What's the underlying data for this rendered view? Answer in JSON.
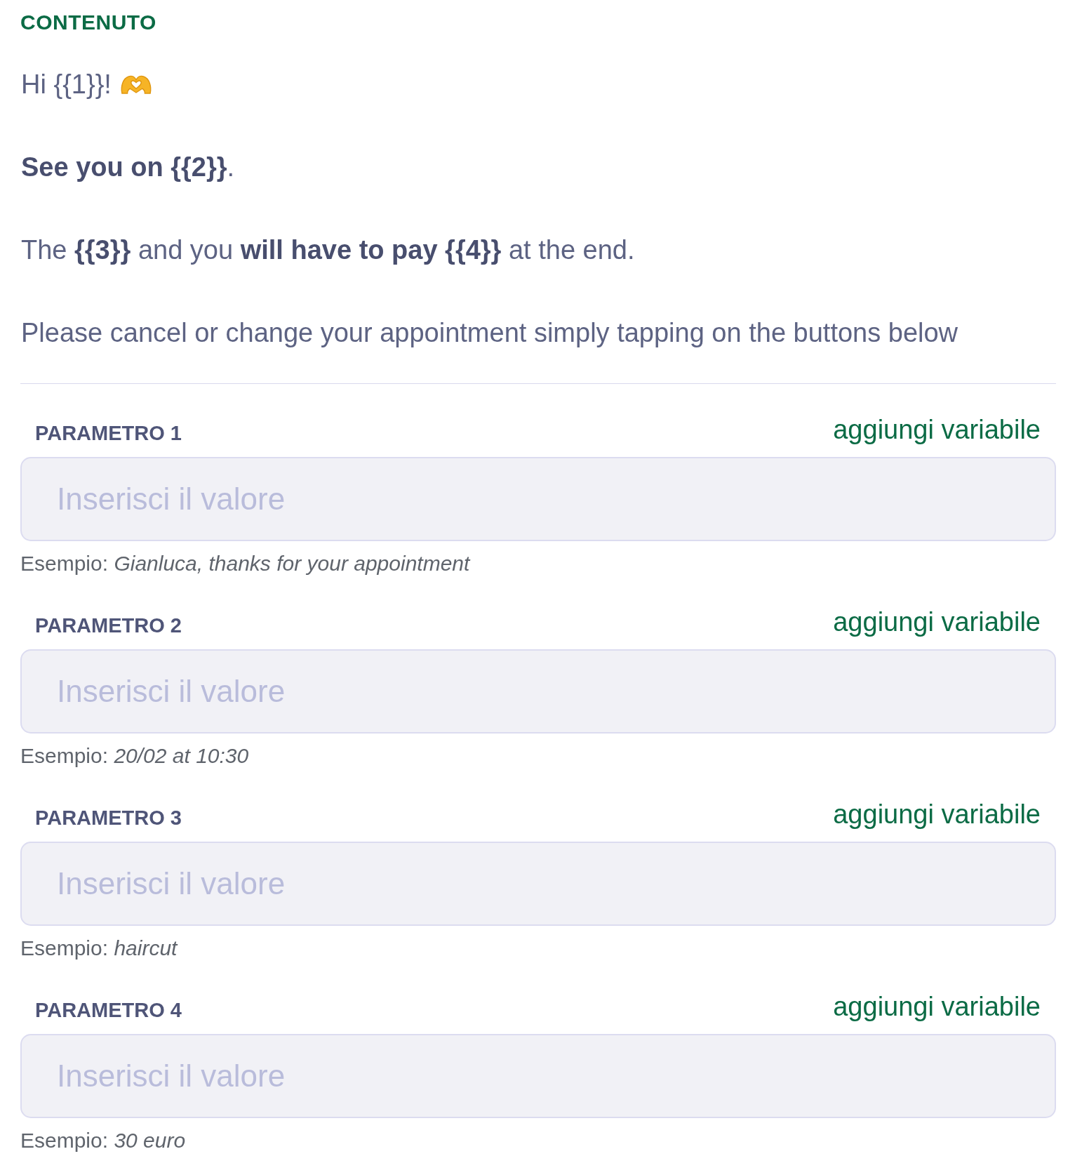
{
  "section_title": "CONTENUTO",
  "message": {
    "paragraphs": [
      "Hi {{1}}!",
      "**See you on {{2}}**.",
      "The **{{3}}** and you **will have to pay {{4}}** at the end.",
      "Please cancel or change your appointment simply tapping on the buttons below"
    ]
  },
  "parameters": [
    {
      "label": "PARAMETRO 1",
      "action": "aggiungi variabile",
      "placeholder": "Inserisci il valore",
      "example": "Esempio: *Gianluca, thanks for your appointment*"
    },
    {
      "label": "PARAMETRO 2",
      "action": "aggiungi variabile",
      "placeholder": "Inserisci il valore",
      "example": "Esempio: *20/02 at 10:30*"
    },
    {
      "label": "PARAMETRO 3",
      "action": "aggiungi variabile",
      "placeholder": "Inserisci il valore",
      "example": "Esempio: *haircut*"
    },
    {
      "label": "PARAMETRO 4",
      "action": "aggiungi variabile",
      "placeholder": "Inserisci il valore",
      "example": "Esempio: *30 euro*"
    }
  ]
}
